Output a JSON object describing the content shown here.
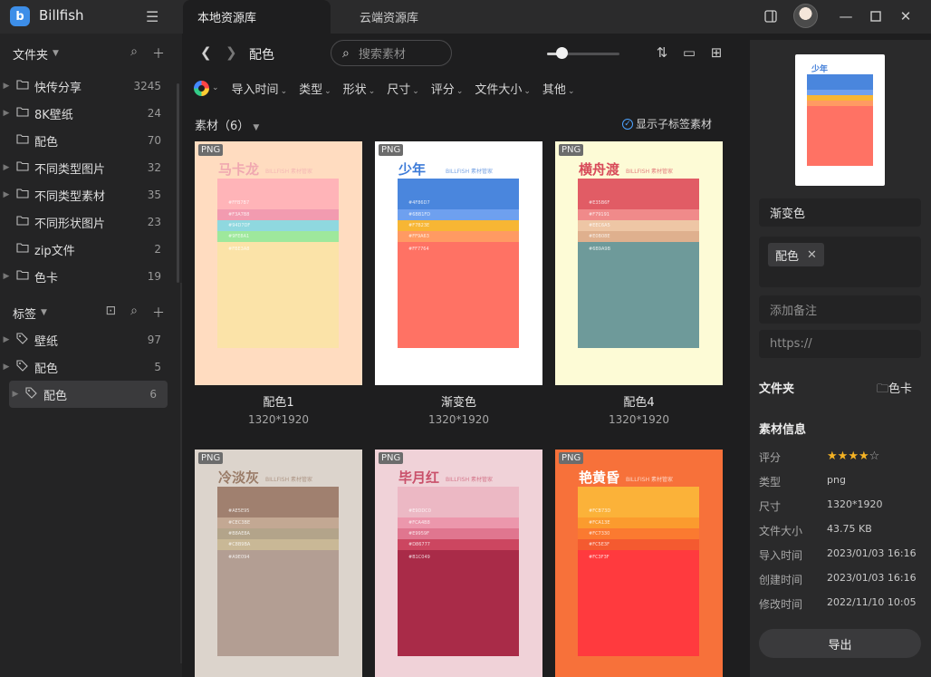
{
  "app": {
    "name": "Billfish",
    "logo_glyph": "b"
  },
  "tabs": [
    {
      "label": "本地资源库"
    },
    {
      "label": "云端资源库"
    }
  ],
  "sidebar": {
    "folders_title": "文件夹",
    "folders": [
      {
        "label": "快传分享",
        "count": "3245",
        "expandable": true
      },
      {
        "label": "8K壁纸",
        "count": "24",
        "expandable": true
      },
      {
        "label": "配色",
        "count": "70",
        "expandable": false
      },
      {
        "label": "不同类型图片",
        "count": "32",
        "expandable": true
      },
      {
        "label": "不同类型素材",
        "count": "35",
        "expandable": true
      },
      {
        "label": "不同形状图片",
        "count": "23",
        "expandable": false
      },
      {
        "label": "zip文件",
        "count": "2",
        "expandable": false
      },
      {
        "label": "色卡",
        "count": "19",
        "expandable": true
      }
    ],
    "tags_title": "标签",
    "tags": [
      {
        "label": "壁纸",
        "count": "97"
      },
      {
        "label": "配色",
        "count": "5"
      },
      {
        "label": "配色",
        "count": "6",
        "active": true
      }
    ]
  },
  "toolbar": {
    "breadcrumb": "配色",
    "search_placeholder": "搜索素材",
    "zoom_level": 0.2,
    "filters": [
      "导入时间",
      "类型",
      "形状",
      "尺寸",
      "评分",
      "文件大小",
      "其他"
    ]
  },
  "grid": {
    "count_label": "素材（6）",
    "show_sub_label": "显示子标签素材",
    "items": [
      {
        "name": "配色1",
        "dim": "1320*1920",
        "badge": "PNG",
        "title": "马卡龙",
        "title_color": "#f0a8b0",
        "sub": "BILLFISH 素材管家",
        "bg": "#ffdcc0",
        "stripes": [
          {
            "c": "#ffb4b8",
            "h": 34,
            "t": "#FFB7B7"
          },
          {
            "c": "#f29bb0",
            "h": 12,
            "t": "#F3A7B8"
          },
          {
            "c": "#8fd8df",
            "h": 12,
            "t": "#94D7DF"
          },
          {
            "c": "#9ee89c",
            "h": 12,
            "t": "#9FE8A1"
          },
          {
            "c": "#fbe3a8",
            "h": 117,
            "t": "#FBE3A8"
          }
        ]
      },
      {
        "name": "渐变色",
        "dim": "1320*1920",
        "badge": "PNG",
        "title": "少年",
        "title_color": "#3d7bd8",
        "sub": "BILLFISH 素材管家",
        "bg": "#ffffff",
        "stripes": [
          {
            "c": "#4a86dd",
            "h": 34,
            "t": "#4F86D7"
          },
          {
            "c": "#6ea0ef",
            "h": 12,
            "t": "#6BB1FD"
          },
          {
            "c": "#f7b634",
            "h": 12,
            "t": "#F7B23E"
          },
          {
            "c": "#ff9a63",
            "h": 12,
            "t": "#FF9A63"
          },
          {
            "c": "#ff7264",
            "h": 117,
            "t": "#FF7764"
          }
        ]
      },
      {
        "name": "配色4",
        "dim": "1320*1920",
        "badge": "PNG",
        "title": "横舟渡",
        "title_color": "#d84b5a",
        "sub": "BILLFISH 素材管家",
        "bg": "#fdfbd6",
        "stripes": [
          {
            "c": "#e15c65",
            "h": 34,
            "t": "#E35B6F"
          },
          {
            "c": "#f08a8a",
            "h": 12,
            "t": "#F79191"
          },
          {
            "c": "#eec6a5",
            "h": 12,
            "t": "#EEC6A5"
          },
          {
            "c": "#dfb08e",
            "h": 12,
            "t": "#E0B08E"
          },
          {
            "c": "#6e9a9a",
            "h": 117,
            "t": "#6B9A9B"
          }
        ]
      },
      {
        "name": "",
        "dim": "",
        "badge": "PNG",
        "title": "冷淡灰",
        "title_color": "#9a7c68",
        "sub": "BILLFISH 素材管家",
        "bg": "#dcd4cc",
        "stripes": [
          {
            "c": "#a0806f",
            "h": 34,
            "t": "#AE5E95"
          },
          {
            "c": "#c3a893",
            "h": 12,
            "t": "#CEC3BE"
          },
          {
            "c": "#b3a48a",
            "h": 12,
            "t": "#B8AE8A"
          },
          {
            "c": "#c9b896",
            "h": 12,
            "t": "#C8B9BA"
          },
          {
            "c": "#b39e93",
            "h": 117,
            "t": "#A9E094"
          }
        ]
      },
      {
        "name": "",
        "dim": "",
        "badge": "PNG",
        "title": "毕月红",
        "title_color": "#c9506a",
        "sub": "BILLFISH 素材管家",
        "bg": "#f0d2d8",
        "stripes": [
          {
            "c": "#ecb8c4",
            "h": 34,
            "t": "#E9DDC0"
          },
          {
            "c": "#ec97ac",
            "h": 12,
            "t": "#FCA4B8"
          },
          {
            "c": "#e0768f",
            "h": 12,
            "t": "#E9959F"
          },
          {
            "c": "#cc4660",
            "h": 12,
            "t": "#D86777"
          },
          {
            "c": "#a92b48",
            "h": 117,
            "t": "#B1C049"
          }
        ]
      },
      {
        "name": "",
        "dim": "",
        "badge": "PNG",
        "title": "艳黄昏",
        "title_color": "#ffffff",
        "sub": "BILLFISH 素材管家",
        "bg": "#f7713a",
        "stripes": [
          {
            "c": "#fbb239",
            "h": 34,
            "t": "#FCB73D"
          },
          {
            "c": "#fb9b2e",
            "h": 12,
            "t": "#FCA13E"
          },
          {
            "c": "#fb7a30",
            "h": 12,
            "t": "#FC7330"
          },
          {
            "c": "#f45a30",
            "h": 12,
            "t": "#FC5E3F"
          },
          {
            "c": "#ff3a3e",
            "h": 117,
            "t": "#FC3F3F"
          }
        ]
      }
    ]
  },
  "detail": {
    "name_value": "渐变色",
    "tag_chip": "配色",
    "note_placeholder": "添加备注",
    "url_placeholder": "https://",
    "folder_label": "文件夹",
    "folder_value": "色卡",
    "info_title": "素材信息",
    "info": [
      {
        "k": "评分",
        "v": ""
      },
      {
        "k": "类型",
        "v": "png"
      },
      {
        "k": "尺寸",
        "v": "1320*1920"
      },
      {
        "k": "文件大小",
        "v": "43.75 KB"
      },
      {
        "k": "导入时间",
        "v": "2023/01/03 16:16"
      },
      {
        "k": "创建时间",
        "v": "2023/01/03 16:16"
      },
      {
        "k": "修改时间",
        "v": "2022/11/10 10:05"
      }
    ],
    "rating": 4,
    "rating_max": 5,
    "export_label": "导出",
    "preview_title": "少年",
    "preview_stripes": [
      "#4a86dd",
      "#6ea0ef",
      "#f7b634",
      "#ff9a63",
      "#ff7264"
    ]
  }
}
